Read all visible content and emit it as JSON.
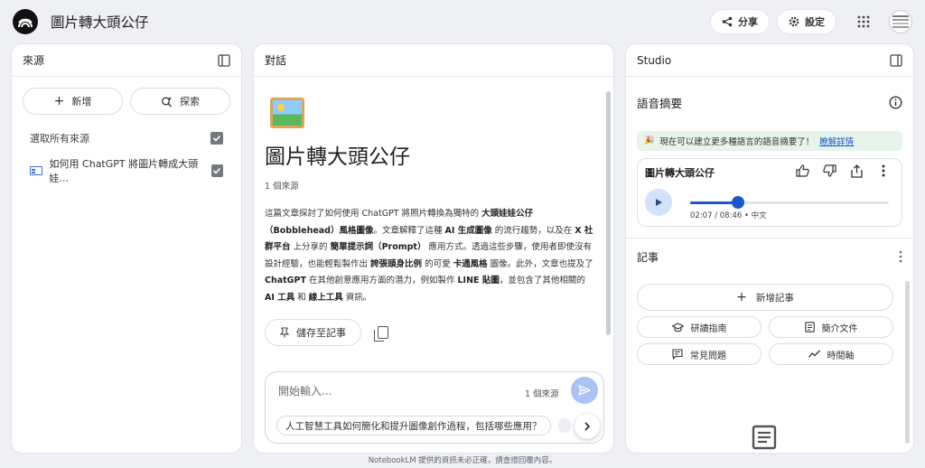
{
  "header": {
    "title": "圖片轉大頭公仔",
    "share_label": "分享",
    "settings_label": "設定"
  },
  "sources": {
    "title": "來源",
    "add_label": "新增",
    "search_label": "探索",
    "select_all_label": "選取所有來源",
    "items": [
      {
        "label": "如何用 ChatGPT 將圖片轉成大頭娃...",
        "checked": true
      }
    ]
  },
  "chat": {
    "title": "對話",
    "note_title": "圖片轉大頭公仔",
    "source_count": "1 個來源",
    "summary": [
      {
        "text": "這篇文章探討了如何使用 ChatGPT 將照片轉換為獨特的 ",
        "bold": false
      },
      {
        "text": "大頭娃娃公仔（Bobblehead）風格圖像",
        "bold": true
      },
      {
        "text": "。文章解釋了這種 ",
        "bold": false
      },
      {
        "text": "AI 生成圖像",
        "bold": true
      },
      {
        "text": " 的流行趨勢，以及在 ",
        "bold": false
      },
      {
        "text": "X 社群平台",
        "bold": true
      },
      {
        "text": " 上分享的 ",
        "bold": false
      },
      {
        "text": "簡單提示詞（Prompt）",
        "bold": true
      },
      {
        "text": " 應用方式。透過這些步驟，使用者即使沒有設計經驗，也能輕鬆製作出 ",
        "bold": false
      },
      {
        "text": "誇張頭身比例",
        "bold": true
      },
      {
        "text": " 的可愛 ",
        "bold": false
      },
      {
        "text": "卡通風格",
        "bold": true
      },
      {
        "text": " 圖像。此外，文章也提及了 ",
        "bold": false
      },
      {
        "text": "ChatGPT",
        "bold": true
      },
      {
        "text": " 在其他創意應用方面的潛力，例如製作 ",
        "bold": false
      },
      {
        "text": "LINE 貼圖",
        "bold": true
      },
      {
        "text": "，並包含了其他相關的 ",
        "bold": false
      },
      {
        "text": "AI 工具",
        "bold": true
      },
      {
        "text": " 和 ",
        "bold": false
      },
      {
        "text": "線上工具",
        "bold": true
      },
      {
        "text": " 資訊。",
        "bold": false
      }
    ],
    "save_label": "儲存至記事",
    "composer": {
      "placeholder": "開始輸入...",
      "source_count": "1 個來源",
      "suggestion": "人工智慧工具如何簡化和提升圖像創作過程，包括哪些應用？"
    }
  },
  "studio": {
    "title": "Studio",
    "audio": {
      "title": "語音摘要",
      "banner_text": "現在可以建立更多種語言的語音摘要了！",
      "banner_link": "瞭解詳情",
      "card_title": "圖片轉大頭公仔",
      "time": "02:07 / 08:46 • 中文",
      "progress": 0.243
    },
    "notes": {
      "title": "記事",
      "add_label": "新增記事",
      "buttons": [
        "研讀指南",
        "簡介文件",
        "常見問題",
        "時間軸"
      ]
    }
  },
  "footer": "NotebookLM 提供的資訊未必正確，請查證回覆內容。",
  "colors": {
    "accent": "#1a57c9",
    "send_bg": "#a9c4f3",
    "banner_bg": "#e6f4ea",
    "checkbox": "#747880"
  }
}
